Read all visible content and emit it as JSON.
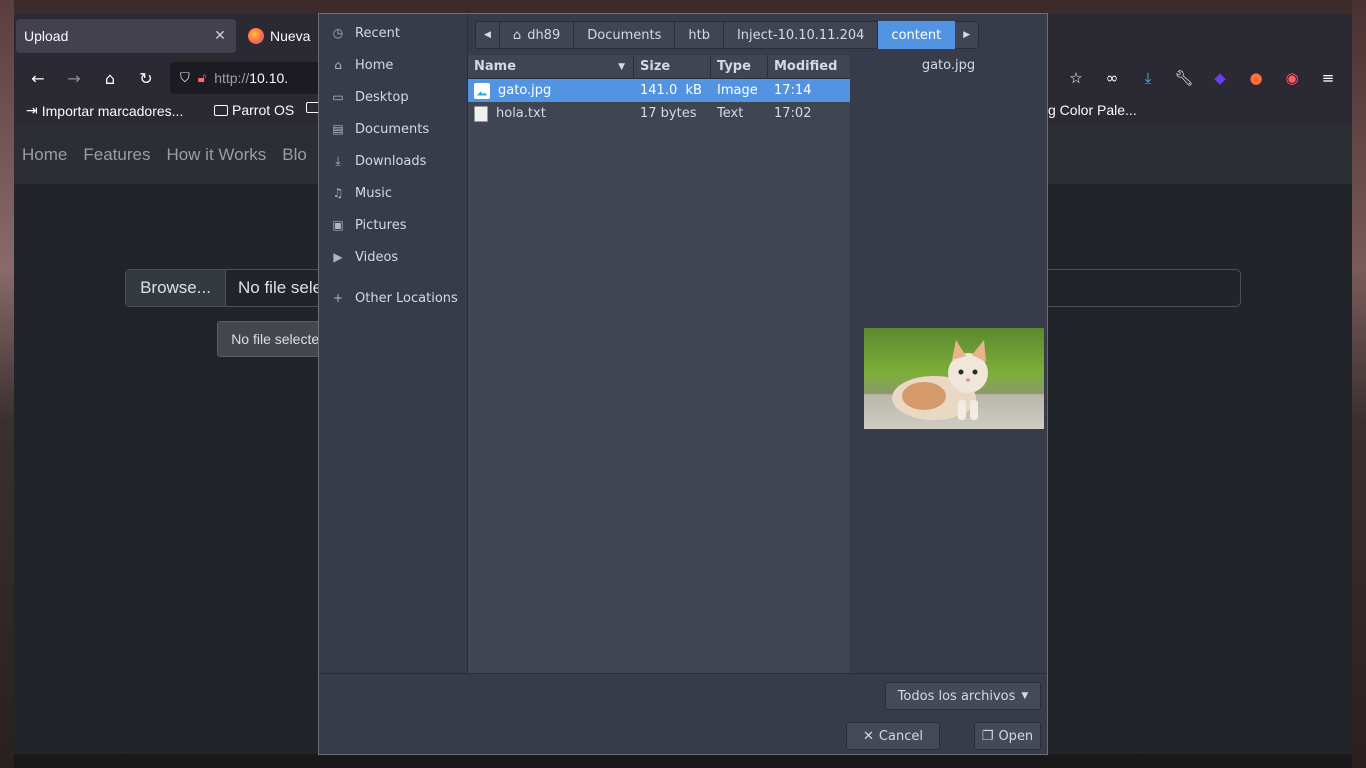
{
  "browser": {
    "tabs": [
      {
        "title": "Upload"
      },
      {
        "title": "Nueva"
      }
    ],
    "url_prefix": "http://",
    "url_host": "10.10.",
    "bookmarks": [
      {
        "label": "Importar marcadores..."
      },
      {
        "label": "Parrot OS"
      },
      {
        "label": "g Color Pale..."
      }
    ]
  },
  "webpage": {
    "nav": [
      "Home",
      "Features",
      "How it Works",
      "Blo"
    ],
    "browse_label": "Browse...",
    "no_file_label": "No file sele",
    "tooltip": "No file selected."
  },
  "dialog": {
    "places": [
      {
        "label": "Recent",
        "icon": "clock-icon"
      },
      {
        "label": "Home",
        "icon": "home-icon"
      },
      {
        "label": "Desktop",
        "icon": "desktop-icon"
      },
      {
        "label": "Documents",
        "icon": "document-icon"
      },
      {
        "label": "Downloads",
        "icon": "download-icon"
      },
      {
        "label": "Music",
        "icon": "music-icon"
      },
      {
        "label": "Pictures",
        "icon": "picture-icon"
      },
      {
        "label": "Videos",
        "icon": "video-icon"
      }
    ],
    "other_locations": "Other Locations",
    "path": [
      "dh89",
      "Documents",
      "htb",
      "Inject-10.10.11.204",
      "content"
    ],
    "columns": {
      "name": "Name",
      "size": "Size",
      "type": "Type",
      "modified": "Modified"
    },
    "files": [
      {
        "name": "gato.jpg",
        "size": "141.0  kB",
        "type": "Image",
        "modified": "17:14"
      },
      {
        "name": "hola.txt",
        "size": "17 bytes",
        "type": "Text",
        "modified": "17:02"
      }
    ],
    "preview_name": "gato.jpg",
    "filter": "Todos los archivos",
    "cancel": "Cancel",
    "open": "Open"
  },
  "colors": {
    "accent": "#5294e2",
    "dialog_bg": "#383c4a",
    "list_bg": "#404552"
  }
}
